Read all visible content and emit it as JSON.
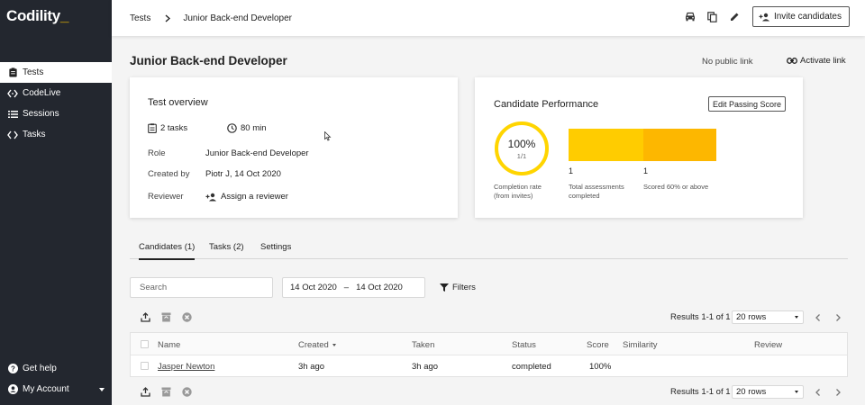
{
  "app": {
    "logo_text": "Codility",
    "logo_underscore": "_"
  },
  "sidebar": {
    "items": [
      {
        "label": "Tests",
        "icon": "clipboard-icon",
        "active": true
      },
      {
        "label": "CodeLive",
        "icon": "code-icon",
        "active": false
      },
      {
        "label": "Sessions",
        "icon": "list-icon",
        "active": false
      },
      {
        "label": "Tasks",
        "icon": "code-icon",
        "active": false
      }
    ],
    "bottom": [
      {
        "label": "Get help",
        "icon": "help-icon"
      },
      {
        "label": "My Account",
        "icon": "account-icon"
      }
    ]
  },
  "topbar": {
    "breadcrumb": [
      "Tests",
      "Junior Back-end Developer"
    ],
    "icons": [
      "car-icon",
      "copy-icon",
      "pencil-icon"
    ],
    "invite_label": "Invite candidates"
  },
  "page": {
    "title": "Junior Back-end Developer",
    "public_link": "No public link",
    "activate_link": "Activate link"
  },
  "overview": {
    "title": "Test overview",
    "tasks": "2 tasks",
    "duration": "80 min",
    "rows": [
      {
        "key": "Role",
        "value": "Junior Back-end Developer"
      },
      {
        "key": "Created by",
        "value": "Piotr J, 14 Oct 2020"
      },
      {
        "key": "Reviewer",
        "value": "Assign a reviewer"
      }
    ]
  },
  "performance": {
    "title": "Candidate Performance",
    "edit_label": "Edit Passing Score",
    "completion_pct": "100%",
    "completion_value": 1.0,
    "completion_frac": "1/1",
    "completion_caption": [
      "Completion rate",
      "(from invites)"
    ],
    "bars": [
      {
        "value": "1",
        "caption": [
          "Total assessments",
          "completed"
        ],
        "color": "#ffcc00"
      },
      {
        "value": "1",
        "caption": [
          "Scored 60% or above"
        ],
        "color": "#fdb700"
      }
    ],
    "ring_color": "#ffd500"
  },
  "tabs": [
    {
      "label": "Candidates (1)",
      "active": true
    },
    {
      "label": "Tasks (2)",
      "active": false
    },
    {
      "label": "Settings",
      "active": false
    }
  ],
  "filters": {
    "search_placeholder": "Search",
    "date_from": "14 Oct 2020",
    "date_sep": "–",
    "date_to": "14 Oct 2020",
    "filters_label": "Filters"
  },
  "table": {
    "results_text": "Results 1-1 of 1",
    "rows_per_page": "20 rows",
    "columns": [
      "Name",
      "Created",
      "Taken",
      "Status",
      "Score",
      "Similarity",
      "Review"
    ],
    "rows": [
      {
        "name": "Jasper Newton",
        "created": "3h ago",
        "taken": "3h ago",
        "status": "completed",
        "score": "100%",
        "similarity": "",
        "review": ""
      }
    ]
  }
}
